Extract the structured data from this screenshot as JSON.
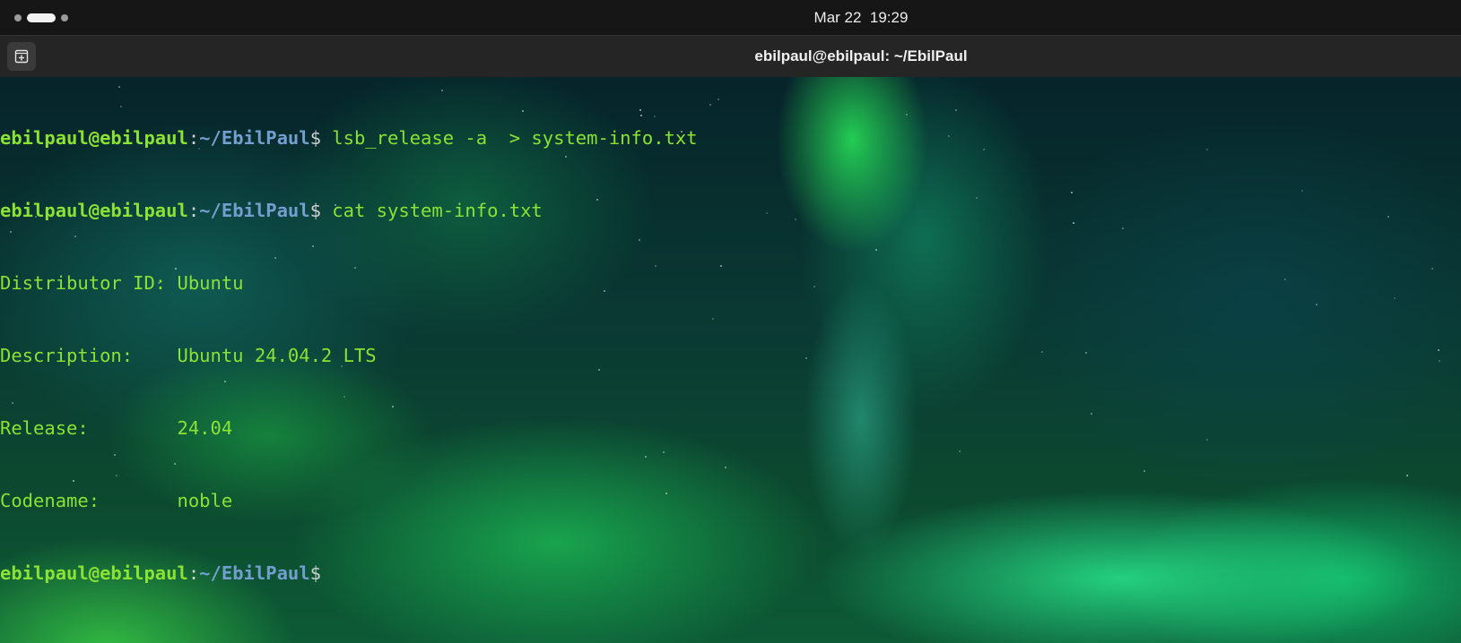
{
  "topbar": {
    "clock": "Mar 22  19:29"
  },
  "window": {
    "title": "ebilpaul@ebilpaul: ~/EbilPaul",
    "new_tab_icon": "new-tab-icon"
  },
  "terminal": {
    "prompt": {
      "user_host": "ebilpaul@ebilpaul",
      "colon": ":",
      "path": "~/EbilPaul",
      "dollar": "$"
    },
    "commands": [
      " lsb_release -a  > system-info.txt",
      " cat system-info.txt"
    ],
    "output": [
      "Distributor ID: Ubuntu",
      "Description:    Ubuntu 24.04.2 LTS",
      "Release:        24.04",
      "Codename:       noble"
    ]
  },
  "colors": {
    "prompt_user": "#8ae234",
    "prompt_path": "#729fcf",
    "text": "#8ae234",
    "topbar_bg": "#161616",
    "header_bg": "#252525"
  }
}
